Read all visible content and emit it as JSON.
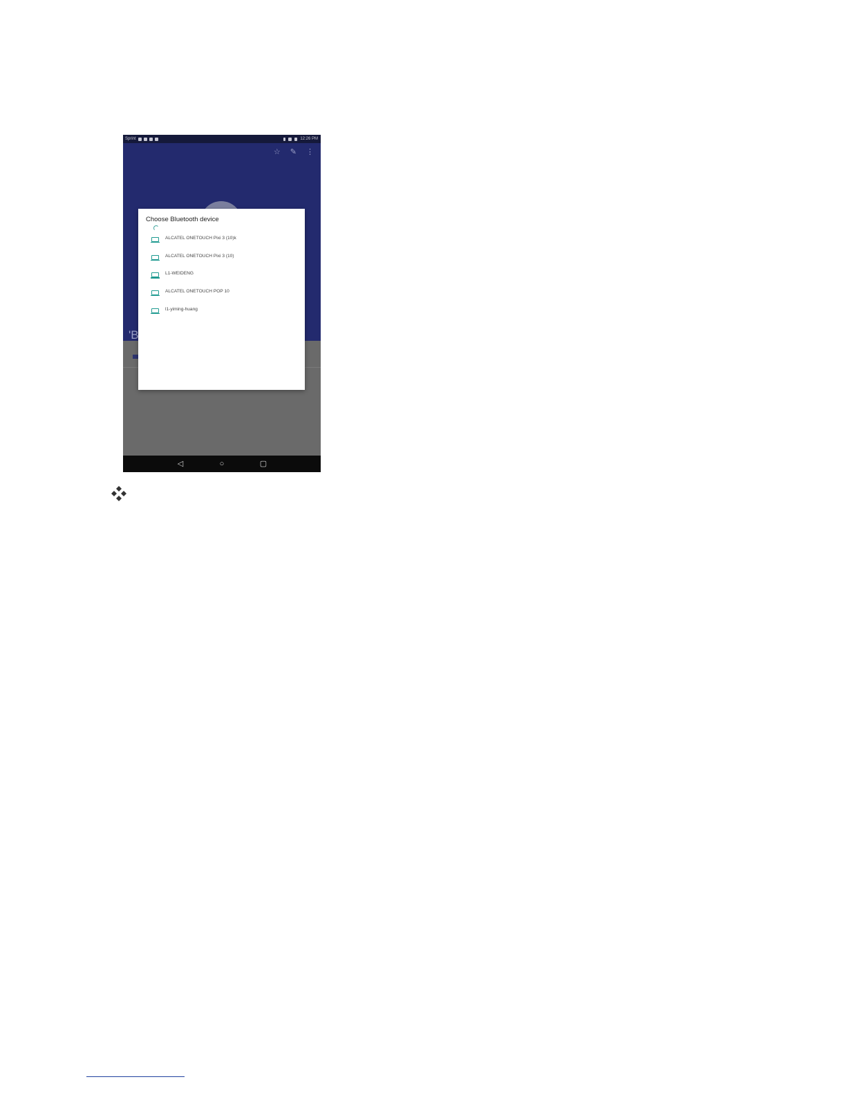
{
  "screenshot": {
    "status_bar": {
      "carrier": "Sprint",
      "time": "12:26 PM"
    },
    "contact_initial": "B",
    "dialog": {
      "title": "Choose Bluetooth device",
      "devices": [
        {
          "name": "ALCATEL ONETOUCH Pixi 3 (10)k",
          "icon": "laptop-icon"
        },
        {
          "name": "ALCATEL ONETOUCH Pixi 3 (10)",
          "icon": "laptop-icon"
        },
        {
          "name": "L1-WEIDENG",
          "icon": "laptop-icon"
        },
        {
          "name": "ALCATEL ONETOUCH POP 10",
          "icon": "laptop-icon"
        },
        {
          "name": "l1-yiming-huang",
          "icon": "laptop-icon"
        }
      ]
    },
    "app_bar_icons": [
      "star-icon",
      "edit-icon",
      "more-icon"
    ],
    "nav_icons": [
      "back-icon",
      "home-icon",
      "recents-icon"
    ]
  },
  "colors": {
    "app_bar": "#232a6e",
    "accent": "#1e9a90",
    "scrim": "#6a6a6a"
  }
}
